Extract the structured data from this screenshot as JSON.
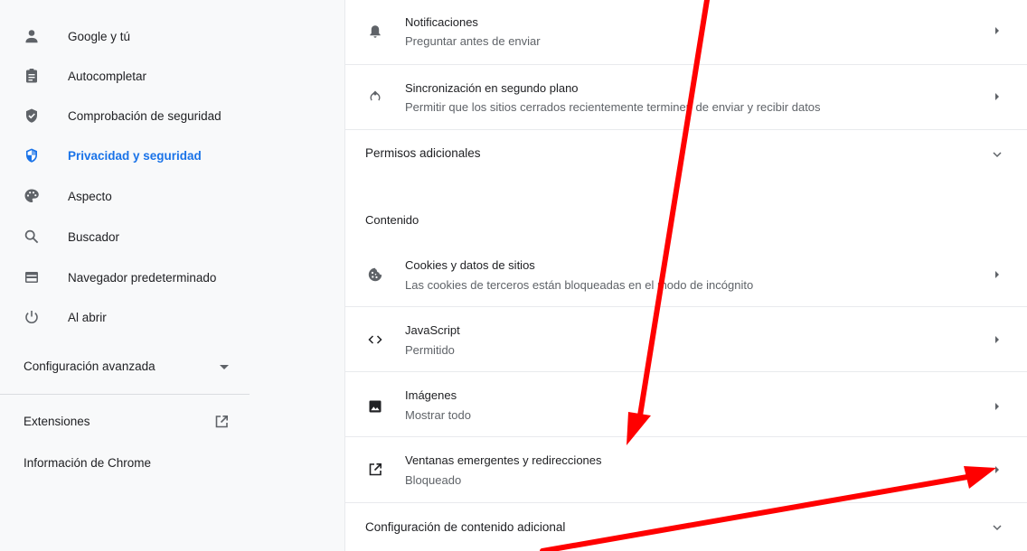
{
  "sidebar": {
    "items": [
      {
        "label": "Google y tú",
        "icon": "person-icon"
      },
      {
        "label": "Autocompletar",
        "icon": "clipboard-icon"
      },
      {
        "label": "Comprobación de seguridad",
        "icon": "shield-check-icon"
      },
      {
        "label": "Privacidad y seguridad",
        "icon": "shield-icon"
      },
      {
        "label": "Aspecto",
        "icon": "palette-icon"
      },
      {
        "label": "Buscador",
        "icon": "search-icon"
      },
      {
        "label": "Navegador predeterminado",
        "icon": "browser-icon"
      },
      {
        "label": "Al abrir",
        "icon": "power-icon"
      }
    ],
    "advanced_label": "Configuración avanzada",
    "extensions_label": "Extensiones",
    "about_label": "Información de Chrome",
    "active_index": 3
  },
  "main": {
    "notifications": {
      "title": "Notificaciones",
      "sub": "Preguntar antes de enviar"
    },
    "background_sync": {
      "title": "Sincronización en segundo plano",
      "sub": "Permitir que los sitios cerrados recientemente terminen de enviar y recibir datos"
    },
    "additional_permissions": "Permisos adicionales",
    "content_heading": "Contenido",
    "cookies": {
      "title": "Cookies y datos de sitios",
      "sub": "Las cookies de terceros están bloqueadas en el modo de incógnito"
    },
    "javascript": {
      "title": "JavaScript",
      "sub": "Permitido"
    },
    "images": {
      "title": "Imágenes",
      "sub": "Mostrar todo"
    },
    "popups": {
      "title": "Ventanas emergentes y redirecciones",
      "sub": "Bloqueado"
    },
    "additional_content": "Configuración de contenido adicional"
  },
  "colors": {
    "accent": "#1a73e8",
    "annotation_arrow": "#ff0000",
    "sidebar_bg": "#f8f9fa"
  }
}
